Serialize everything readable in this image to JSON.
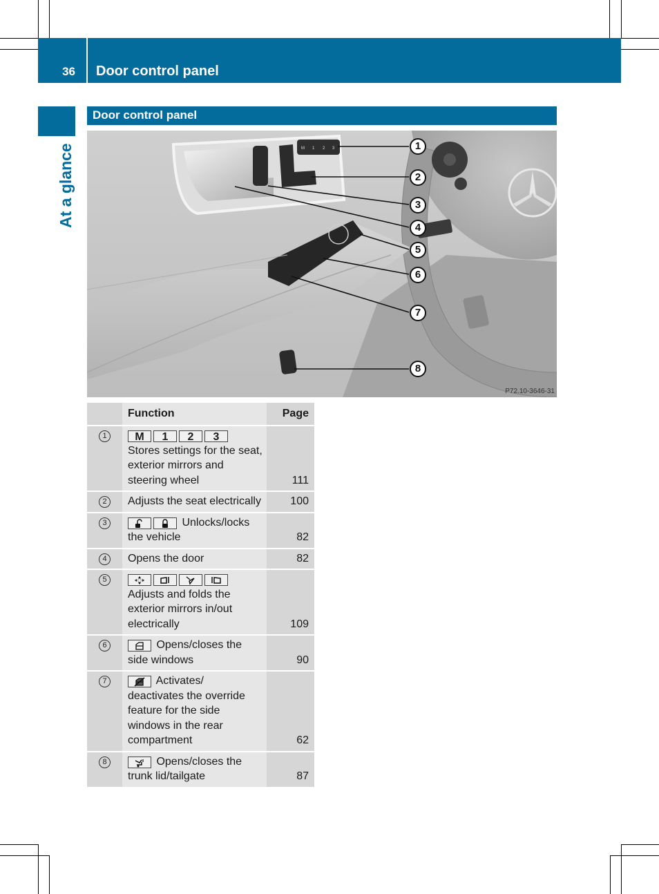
{
  "header": {
    "page_number": "36",
    "title": "Door control panel"
  },
  "side_tab": {
    "label": "At a glance"
  },
  "section": {
    "title": "Door control panel"
  },
  "figure": {
    "code": "P72.10-3646-31",
    "callouts": [
      "1",
      "2",
      "3",
      "4",
      "5",
      "6",
      "7",
      "8"
    ],
    "seat_memory_keys": [
      "M",
      "1",
      "2",
      "3"
    ]
  },
  "table": {
    "headers": {
      "number": "",
      "function": "Function",
      "page": "Page"
    },
    "rows": [
      {
        "num": "1",
        "icons": [
          "memory-m-key",
          "memory-1-key",
          "memory-2-key",
          "memory-3-key"
        ],
        "key_labels": [
          "M",
          "1",
          "2",
          "3"
        ],
        "text": "Stores settings for the seat, exterior mirrors and steering wheel",
        "page": "111"
      },
      {
        "num": "2",
        "icons": [],
        "text": "Adjusts the seat electrically",
        "page": "100"
      },
      {
        "num": "3",
        "icons": [
          "unlock-icon",
          "lock-icon"
        ],
        "text": "Unlocks/locks the vehicle",
        "page": "82"
      },
      {
        "num": "4",
        "icons": [],
        "text": "Opens the door",
        "page": "82"
      },
      {
        "num": "5",
        "icons": [
          "mirror-adjust-icon",
          "mirror-left-icon",
          "mirror-fold-icon",
          "mirror-right-icon"
        ],
        "text": "Adjusts and folds the exterior mirrors in/out electrically",
        "page": "109"
      },
      {
        "num": "6",
        "icons": [
          "side-window-icon"
        ],
        "text": "Opens/closes the side windows",
        "page": "90"
      },
      {
        "num": "7",
        "icons": [
          "rear-window-override-icon"
        ],
        "text": "Activates/ deactivates the override feature for the side windows in the rear compartment",
        "page": "62"
      },
      {
        "num": "8",
        "icons": [
          "trunk-lid-icon"
        ],
        "text": "Opens/closes the trunk lid/tailgate",
        "page": "87"
      }
    ]
  },
  "colors": {
    "brand_blue": "#046c9c",
    "table_dark": "#d6d6d6",
    "table_light": "#e6e6e6"
  }
}
